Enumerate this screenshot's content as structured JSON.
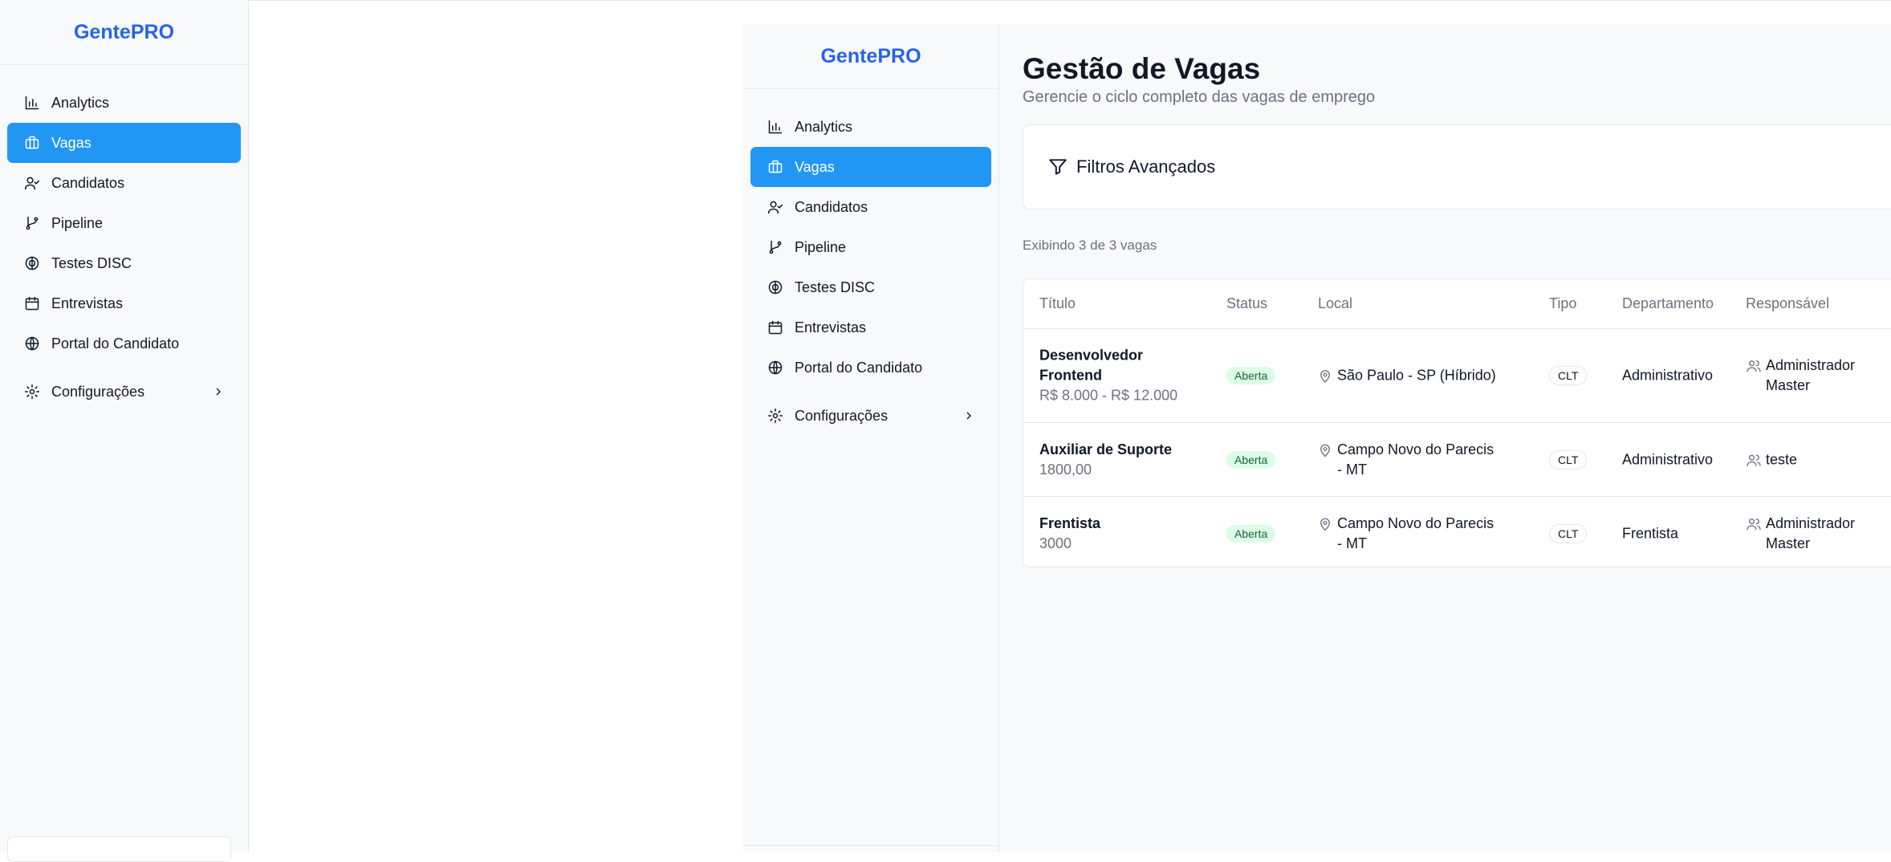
{
  "brand": "GentePRO",
  "nav": [
    {
      "label": "Analytics",
      "icon": "bar-chart-icon"
    },
    {
      "label": "Vagas",
      "icon": "briefcase-icon",
      "active": true
    },
    {
      "label": "Candidatos",
      "icon": "user-check-icon"
    },
    {
      "label": "Pipeline",
      "icon": "git-branch-icon"
    },
    {
      "label": "Testes DISC",
      "icon": "brain-icon"
    },
    {
      "label": "Entrevistas",
      "icon": "calendar-icon"
    },
    {
      "label": "Portal do Candidato",
      "icon": "globe-icon"
    },
    {
      "label": "Configurações",
      "icon": "gear-icon"
    }
  ],
  "page": {
    "title": "Gestão de Vagas",
    "subtitle": "Gerencie o ciclo completo das vagas de emprego"
  },
  "filters": {
    "label": "Filtros Avançados"
  },
  "count_text": "Exibindo 3 de 3 vagas",
  "table": {
    "headers": [
      "Título",
      "Status",
      "Local",
      "Tipo",
      "Departamento",
      "Responsável"
    ],
    "rows": [
      {
        "titulo": "Desenvolvedor Frontend",
        "salario": "R$ 8.000 - R$ 12.000",
        "status": "Aberta",
        "local": "São Paulo - SP (Híbrido)",
        "tipo": "CLT",
        "departamento": "Administrativo",
        "responsavel": "Administrador Master"
      },
      {
        "titulo": "Auxiliar de Suporte",
        "salario": "1800,00",
        "status": "Aberta",
        "local": "Campo Novo do Parecis - MT",
        "tipo": "CLT",
        "departamento": "Administrativo",
        "responsavel": "teste"
      },
      {
        "titulo": "Frentista",
        "salario": "3000",
        "status": "Aberta",
        "local": "Campo Novo do Parecis - MT",
        "tipo": "CLT",
        "departamento": "Frentista",
        "responsavel": "Administrador Master"
      }
    ]
  },
  "colors": {
    "brand": "#2563eb",
    "active_nav": "#2196f3",
    "status_open_bg": "#dcfce7",
    "status_open_text": "#166534"
  }
}
